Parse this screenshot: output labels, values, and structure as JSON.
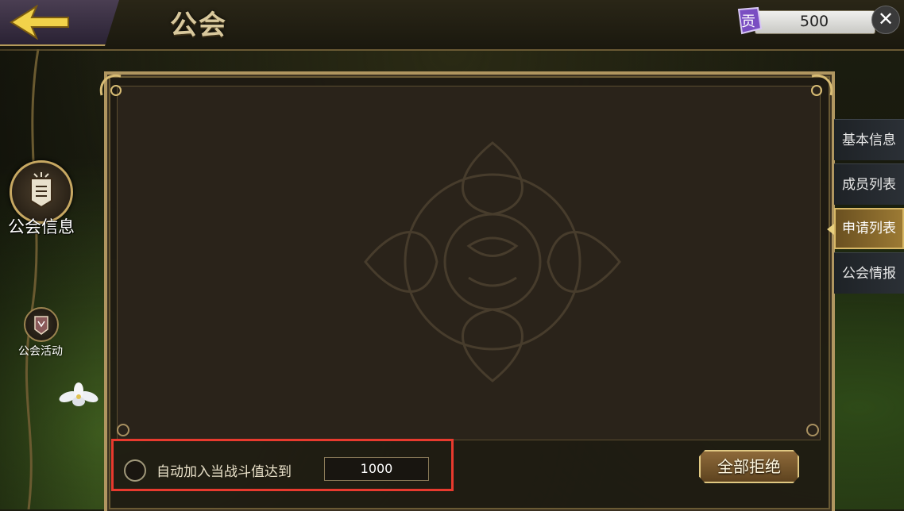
{
  "header": {
    "title": "公会",
    "currency_icon": "contribution-icon",
    "currency_icon_glyph": "贡",
    "currency_value": "500",
    "close_glyph": "✕"
  },
  "left_nav": {
    "items": [
      {
        "label": "公会信息",
        "icon": "guild-banner-icon"
      },
      {
        "label": "公会活动",
        "icon": "guild-shield-icon"
      }
    ]
  },
  "right_tabs": {
    "items": [
      {
        "label": "基本信息"
      },
      {
        "label": "成员列表"
      },
      {
        "label": "申请列表",
        "active": true
      },
      {
        "label": "公会情报"
      }
    ]
  },
  "footer": {
    "auto_join_label": "自动加入当战斗值达到",
    "power_threshold": "1000",
    "reject_all_label": "全部拒绝"
  },
  "colors": {
    "gold_border": "#b09660",
    "highlight_red": "#e83a2e",
    "active_tab": "#9c7a34"
  }
}
